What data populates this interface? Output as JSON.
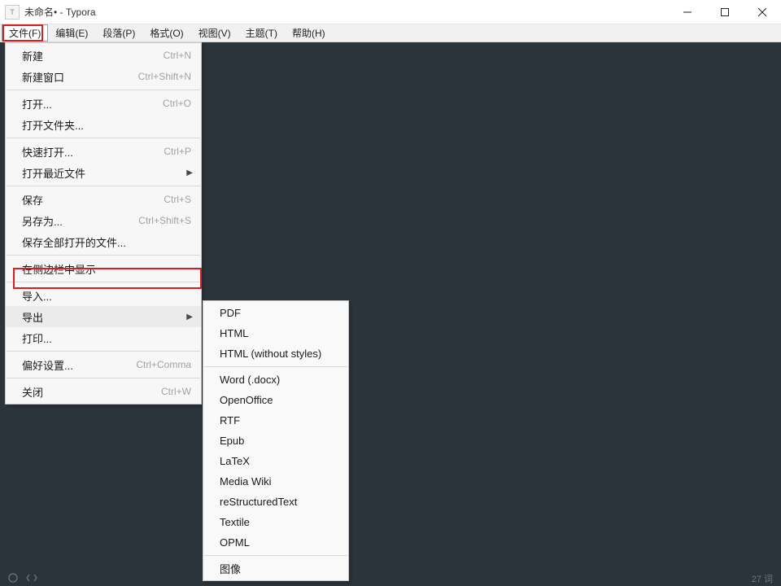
{
  "window": {
    "title": "未命名• - Typora"
  },
  "menubar": {
    "items": [
      {
        "label": "文件(F)",
        "active": true
      },
      {
        "label": "编辑(E)"
      },
      {
        "label": "段落(P)"
      },
      {
        "label": "格式(O)"
      },
      {
        "label": "视图(V)"
      },
      {
        "label": "主题(T)"
      },
      {
        "label": "帮助(H)"
      }
    ]
  },
  "file_menu": {
    "groups": [
      [
        {
          "label": "新建",
          "shortcut": "Ctrl+N"
        },
        {
          "label": "新建窗口",
          "shortcut": "Ctrl+Shift+N"
        }
      ],
      [
        {
          "label": "打开...",
          "shortcut": "Ctrl+O"
        },
        {
          "label": "打开文件夹..."
        }
      ],
      [
        {
          "label": "快速打开...",
          "shortcut": "Ctrl+P"
        },
        {
          "label": "打开最近文件",
          "submenu": true
        }
      ],
      [
        {
          "label": "保存",
          "shortcut": "Ctrl+S"
        },
        {
          "label": "另存为...",
          "shortcut": "Ctrl+Shift+S"
        },
        {
          "label": "保存全部打开的文件..."
        }
      ],
      [
        {
          "label": "在侧边栏中显示"
        }
      ],
      [
        {
          "label": "导入..."
        },
        {
          "label": "导出",
          "submenu": true,
          "highlight": true
        },
        {
          "label": "打印..."
        }
      ],
      [
        {
          "label": "偏好设置...",
          "shortcut": "Ctrl+Comma"
        }
      ],
      [
        {
          "label": "关闭",
          "shortcut": "Ctrl+W"
        }
      ]
    ]
  },
  "export_submenu": {
    "groups": [
      [
        {
          "label": "PDF"
        },
        {
          "label": "HTML"
        },
        {
          "label": "HTML (without styles)"
        }
      ],
      [
        {
          "label": "Word (.docx)"
        },
        {
          "label": "OpenOffice"
        },
        {
          "label": "RTF"
        },
        {
          "label": "Epub"
        },
        {
          "label": "LaTeX"
        },
        {
          "label": "Media Wiki"
        },
        {
          "label": "reStructuredText"
        },
        {
          "label": "Textile"
        },
        {
          "label": "OPML"
        }
      ],
      [
        {
          "label": "图像"
        }
      ]
    ]
  },
  "statusbar": {
    "word_count": "27 词"
  }
}
